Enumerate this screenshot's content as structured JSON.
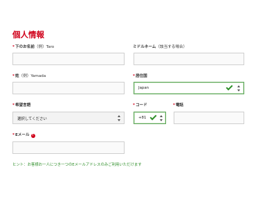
{
  "section": {
    "title": "個人情報"
  },
  "fields": {
    "first_name": {
      "required": "*",
      "label": "下のお名前",
      "note": "（例）Taro",
      "value": ""
    },
    "middle_name": {
      "label": "ミドルネーム",
      "note": "（該当する場合）",
      "value": ""
    },
    "last_name": {
      "required": "*",
      "label": "姓",
      "note": "（例）Yamada",
      "value": ""
    },
    "residence": {
      "required": "*",
      "label": "居住国",
      "value": "Japan"
    },
    "language": {
      "required": "*",
      "label": "希望言語",
      "value": "選択してください"
    },
    "country_code": {
      "required": "*",
      "label": "コード",
      "value": "+81"
    },
    "phone": {
      "required": "*",
      "label": "電話",
      "value": ""
    },
    "email": {
      "required": "*",
      "label": "Eメール",
      "info_icon": "!",
      "value": ""
    }
  },
  "hint": "ヒント：お客様お一人につき一つのEメールアドレスのみご利用いただけます",
  "colors": {
    "accent": "#d0021b",
    "valid": "#2f8f2a"
  },
  "icons": {
    "valid": "check-icon",
    "select": "chevron-updown-icon",
    "info": "info-icon"
  }
}
